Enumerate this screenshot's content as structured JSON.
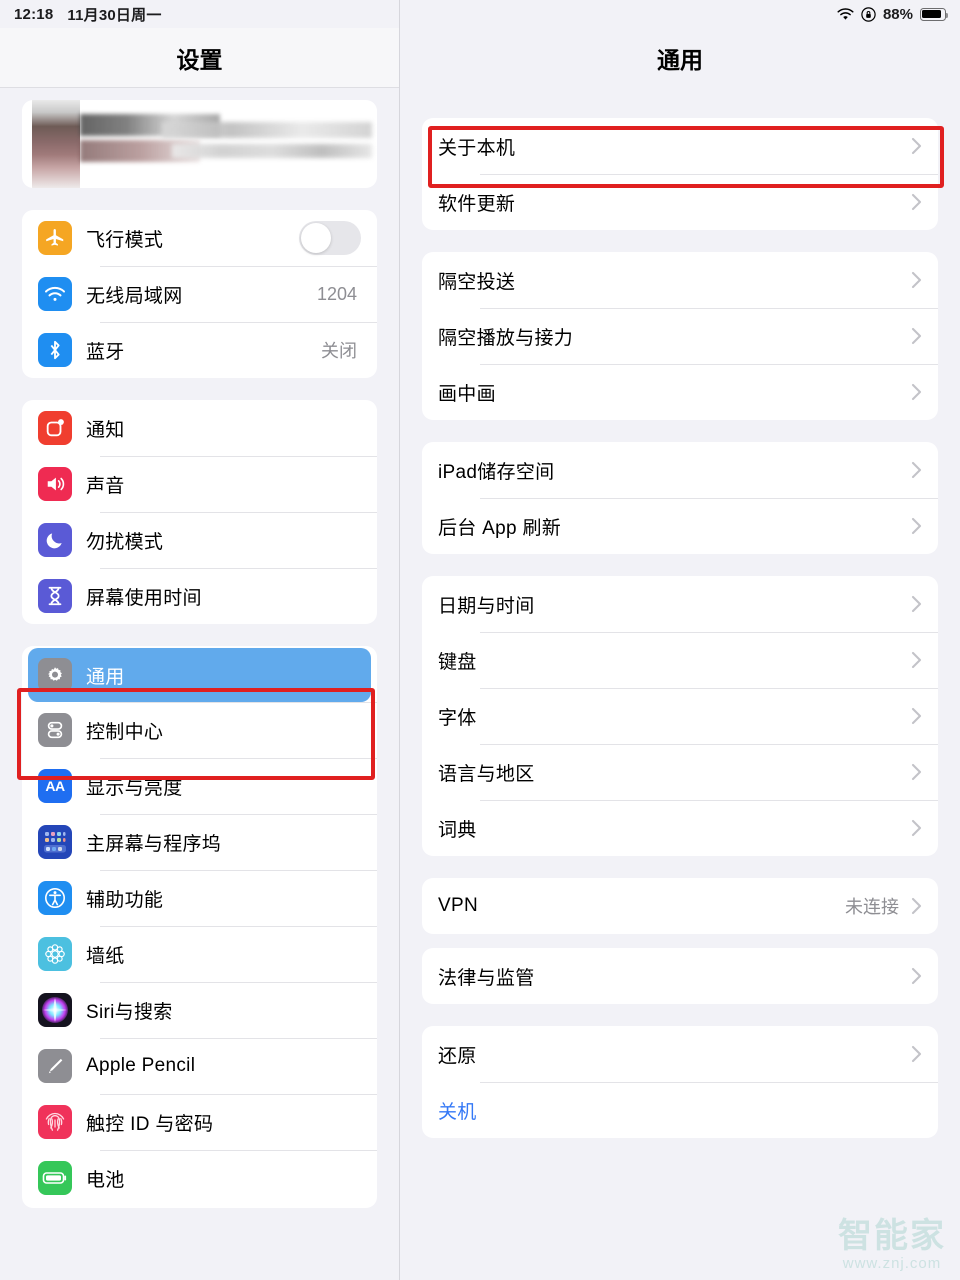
{
  "statusbar": {
    "time": "12:18",
    "date": "11月30日周一",
    "battery_percent": "88%",
    "battery_level": 88,
    "icons": [
      "wifi-icon",
      "rotation-lock-icon",
      "battery-icon"
    ]
  },
  "sidebar": {
    "title": "设置",
    "account": {
      "blurred": true
    },
    "groups": [
      {
        "items": [
          {
            "label": "飞行模式",
            "icon": "airplane-icon",
            "icon_color": "#f5a623",
            "control": "toggle",
            "toggle_on": false
          },
          {
            "label": "无线局域网",
            "icon": "wifi-icon",
            "icon_color": "#1f8ef1",
            "value": "1204"
          },
          {
            "label": "蓝牙",
            "icon": "bluetooth-icon",
            "icon_color": "#1f8ef1",
            "value": "关闭"
          }
        ]
      },
      {
        "items": [
          {
            "label": "通知",
            "icon": "notification-icon",
            "icon_color": "#f03e2f"
          },
          {
            "label": "声音",
            "icon": "sound-icon",
            "icon_color": "#ef2b52"
          },
          {
            "label": "勿扰模式",
            "icon": "moon-icon",
            "icon_color": "#5a5ad6"
          },
          {
            "label": "屏幕使用时间",
            "icon": "hourglass-icon",
            "icon_color": "#5a5ad6"
          }
        ]
      },
      {
        "items": [
          {
            "label": "通用",
            "icon": "gear-icon",
            "icon_color": "#8e8e93",
            "selected": true
          },
          {
            "label": "控制中心",
            "icon": "control-center-icon",
            "icon_color": "#8e8e93"
          },
          {
            "label": "显示与亮度",
            "icon": "display-icon",
            "icon_color": "#1f6ef1"
          },
          {
            "label": "主屏幕与程序坞",
            "icon": "home-screen-icon",
            "icon_color": "#2446b8"
          },
          {
            "label": "辅助功能",
            "icon": "accessibility-icon",
            "icon_color": "#1f8ef1"
          },
          {
            "label": "墙纸",
            "icon": "wallpaper-icon",
            "icon_color": "#4cc0e0"
          },
          {
            "label": "Siri与搜索",
            "icon": "siri-icon",
            "icon_color": "#1c1c2e"
          },
          {
            "label": "Apple Pencil",
            "icon": "pencil-icon",
            "icon_color": "#8e8e93"
          },
          {
            "label": "触控 ID 与密码",
            "icon": "touchid-icon",
            "icon_color": "#f0325a"
          },
          {
            "label": "电池",
            "icon": "battery-icon",
            "icon_color": "#35c759"
          }
        ]
      }
    ]
  },
  "detail": {
    "title": "通用",
    "groups": [
      {
        "items": [
          {
            "label": "关于本机",
            "chevron": true,
            "highlighted": true
          },
          {
            "label": "软件更新",
            "chevron": true
          }
        ]
      },
      {
        "items": [
          {
            "label": "隔空投送",
            "chevron": true
          },
          {
            "label": "隔空播放与接力",
            "chevron": true
          },
          {
            "label": "画中画",
            "chevron": true
          }
        ]
      },
      {
        "items": [
          {
            "label": "iPad储存空间",
            "chevron": true
          },
          {
            "label": "后台 App 刷新",
            "chevron": true
          }
        ]
      },
      {
        "items": [
          {
            "label": "日期与时间",
            "chevron": true
          },
          {
            "label": "键盘",
            "chevron": true
          },
          {
            "label": "字体",
            "chevron": true
          },
          {
            "label": "语言与地区",
            "chevron": true
          },
          {
            "label": "词典",
            "chevron": true
          }
        ]
      },
      {
        "items": [
          {
            "label": "VPN",
            "value": "未连接",
            "chevron": true
          }
        ]
      },
      {
        "items": [
          {
            "label": "法律与监管",
            "chevron": true
          }
        ]
      },
      {
        "items": [
          {
            "label": "还原",
            "chevron": true
          },
          {
            "label": "关机",
            "link": true
          }
        ]
      }
    ]
  },
  "annotations": {
    "highlight_color": "#e02020",
    "boxes": [
      {
        "target": "sidebar-item-general"
      },
      {
        "target": "detail-item-about"
      }
    ]
  },
  "watermark": {
    "main": "智能家",
    "sub": "www.znj.com"
  }
}
